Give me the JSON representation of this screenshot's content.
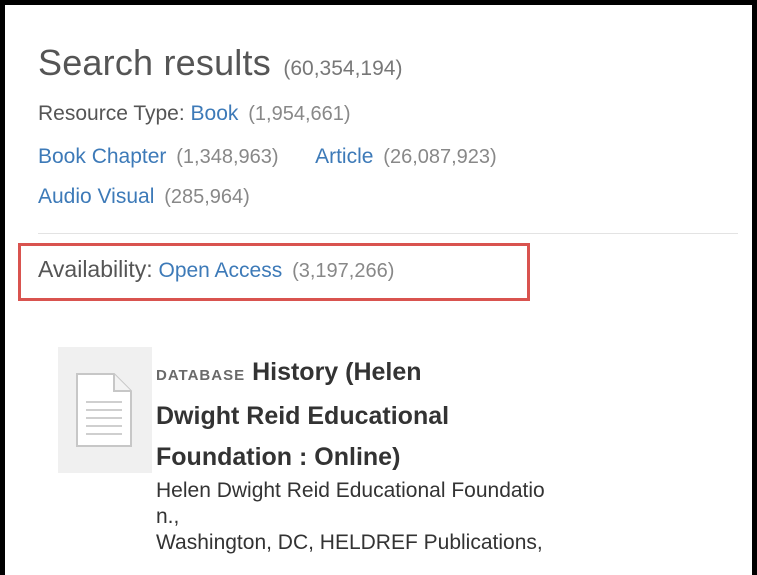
{
  "search": {
    "title": "Search results",
    "count": "(60,354,194)"
  },
  "facets": {
    "resource_type_label": "Resource Type:",
    "items": [
      {
        "label": "Book",
        "count": "(1,954,661)"
      },
      {
        "label": "Book Chapter",
        "count": "(1,348,963)"
      },
      {
        "label": "Article",
        "count": "(26,087,923)"
      },
      {
        "label": "Audio Visual",
        "count": "(285,964)"
      }
    ],
    "availability_label": "Availability:",
    "availability": {
      "label": "Open Access",
      "count": "(3,197,266)"
    }
  },
  "result": {
    "type": "DATABASE",
    "title_lines": [
      "History (Helen",
      "Dwight Reid Educational",
      "Foundation : Online)"
    ],
    "meta_lines": [
      "Helen Dwight Reid Educational Foundatio",
      "n.,",
      "Washington, DC, HELDREF Publications,"
    ]
  },
  "colors": {
    "link": "#3d7ab8",
    "highlight_border": "#d9534f"
  },
  "icons": {
    "thumbnail": "document-icon"
  }
}
